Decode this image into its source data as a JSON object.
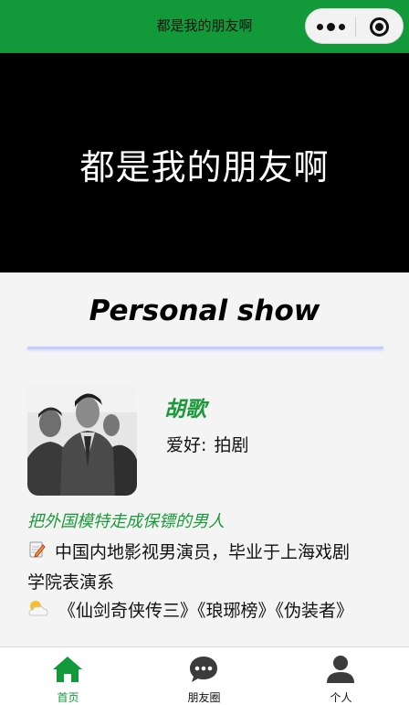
{
  "navbar": {
    "title": "都是我的朋友啊",
    "menu_icon": "more-dots-icon",
    "close_icon": "target-icon"
  },
  "banner": {
    "text": "都是我的朋友啊"
  },
  "section": {
    "title": "Personal show"
  },
  "profile": {
    "name": "胡歌",
    "hobby_label": "爱好:",
    "hobby_value": "拍剧",
    "tagline": "把外国模特走成保镖的男人",
    "bio_1": "中国内地影视男演员，毕业于上海戏剧学院表演系",
    "bio_2": "《仙剑奇侠传三》《琅琊榜》《伪装者》",
    "bio_1_icon": "memo-icon",
    "bio_2_icon": "sun-behind-cloud-icon"
  },
  "tabbar": {
    "tabs": [
      {
        "label": "首页",
        "icon": "home-icon",
        "active": true
      },
      {
        "label": "朋友圈",
        "icon": "chat-bubble-icon",
        "active": false
      },
      {
        "label": "个人",
        "icon": "person-icon",
        "active": false
      }
    ]
  },
  "colors": {
    "brand_green": "#129a3a",
    "banner_bg": "#000000",
    "divider": "#c9cdfb"
  }
}
